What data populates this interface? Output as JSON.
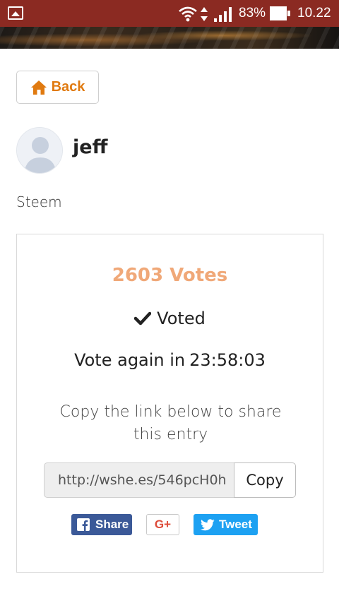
{
  "status_bar": {
    "battery_text": "83%",
    "time": "10.22",
    "icons": [
      "gallery-icon",
      "wifi-icon",
      "data-arrows-icon",
      "signal-icon",
      "battery-icon"
    ]
  },
  "nav": {
    "back_label": "Back",
    "back_icon": "home-icon"
  },
  "profile": {
    "username": "jeff",
    "subtitle": "Steem",
    "avatar_icon": "avatar-icon"
  },
  "vote_card": {
    "votes": "2603 Votes",
    "status_label": "Voted",
    "status_icon": "checkmark-icon",
    "countdown_label": "Vote again in",
    "countdown_time": "23:58:03",
    "share_text": "Copy the link below to share this entry",
    "link_value": "http://wshe.es/546pcH0h",
    "copy_label": "Copy"
  },
  "social": {
    "facebook_label": "Share",
    "google_label": "G+",
    "twitter_label": "Tweet"
  },
  "colors": {
    "status_bar": "#8b2a22",
    "accent": "#e07a10",
    "votes": "#f0a878",
    "facebook": "#3b5998",
    "twitter": "#1da1f2",
    "google": "#dd4b39"
  }
}
